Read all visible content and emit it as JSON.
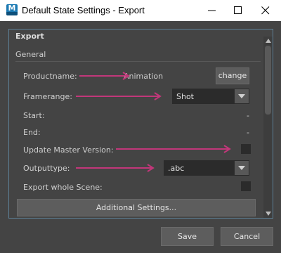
{
  "window": {
    "title": "Default State Settings - Export",
    "app_icon": "maya-icon"
  },
  "group": {
    "title": "Export",
    "section_title": "General"
  },
  "fields": {
    "productname": {
      "label": "Productname:",
      "value": "Animation",
      "button_label": "change"
    },
    "framerange": {
      "label": "Framerange:",
      "selected": "Shot"
    },
    "start": {
      "label": "Start:",
      "value": "-"
    },
    "end": {
      "label": "End:",
      "value": "-"
    },
    "update_master_version": {
      "label": "Update Master Version:",
      "checked": false
    },
    "outputtype": {
      "label": "Outputtype:",
      "selected": ".abc"
    },
    "export_whole_scene": {
      "label": "Export whole Scene:",
      "checked": false
    }
  },
  "additional_settings_label": "Additional Settings...",
  "footer": {
    "save_label": "Save",
    "cancel_label": "Cancel"
  },
  "colors": {
    "annotation_arrow": "#c2377a",
    "group_border": "#5d7f95",
    "background": "#444444"
  }
}
